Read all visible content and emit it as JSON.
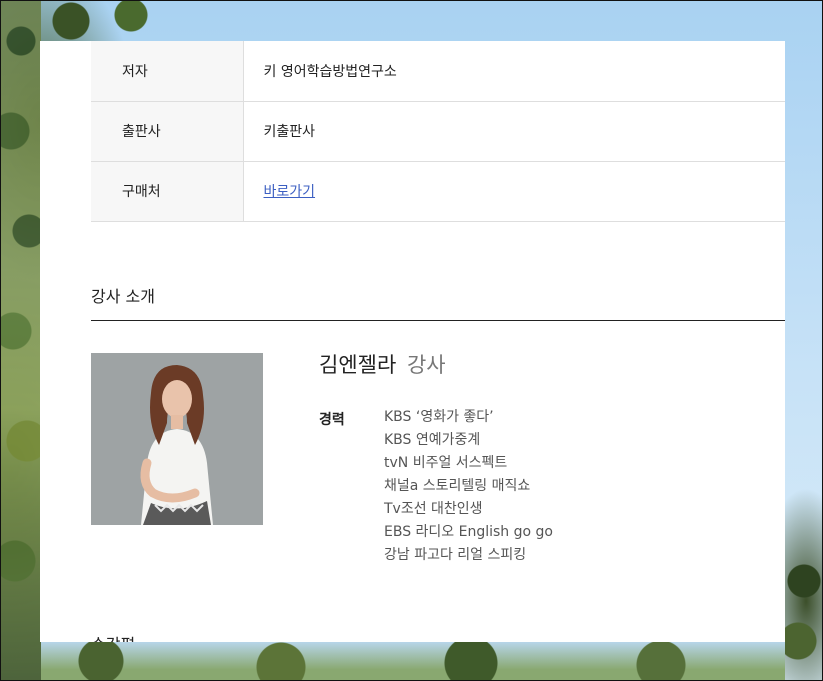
{
  "book_info": {
    "rows": [
      {
        "label": "저자",
        "value": "키 영어학습방법연구소"
      },
      {
        "label": "출판사",
        "value": "키출판사"
      },
      {
        "label": "구매처",
        "value": "바로가기"
      }
    ]
  },
  "instructor": {
    "section_title": "강사 소개",
    "name": "김엔젤라",
    "role": "강사",
    "career_label": "경력",
    "career": [
      "KBS ‘영화가 좋다’",
      "KBS 연예가중계",
      "tvN 비주얼 서스펙트",
      "채널a 스토리텔링 매직쇼",
      "Tv조선 대찬인생",
      "EBS 라디오 English go go",
      "강남 파고다 리얼 스피킹"
    ]
  },
  "next_section": {
    "title": "수강평"
  },
  "colors": {
    "link": "#3c5fc2",
    "header_bg": "#f7f7f7",
    "border": "#dedede"
  }
}
